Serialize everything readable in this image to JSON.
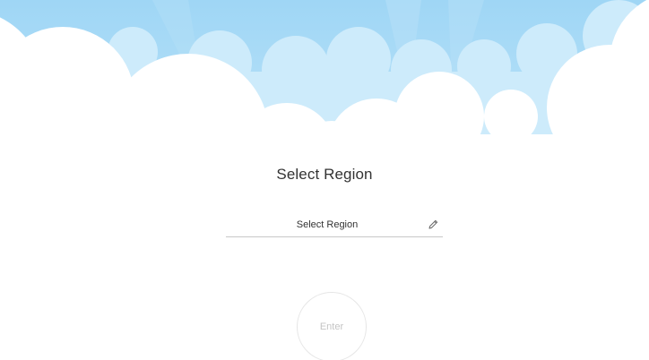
{
  "title": "Select Region",
  "region_field": {
    "value": "Select Region",
    "icon": "pencil-icon"
  },
  "enter_button": {
    "label": "Enter"
  },
  "colors": {
    "sky_back": "#A6DCF7",
    "sky_front": "#C9E9FA",
    "cloud": "#FFFFFF",
    "title_text": "#333333",
    "underline": "#C8C8C8",
    "button_text": "#C4C4C4"
  }
}
